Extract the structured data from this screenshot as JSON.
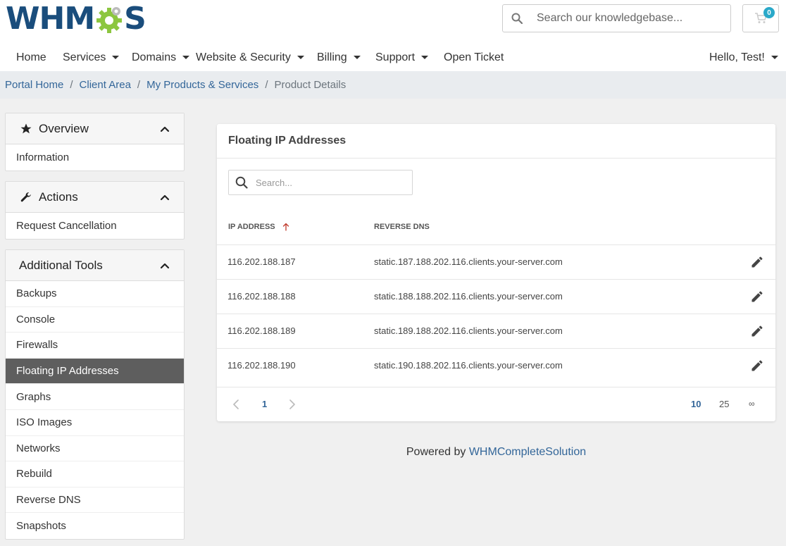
{
  "header": {
    "logo_letters_left": "WHM",
    "logo_letters_right": "S",
    "search_placeholder": "Search our knowledgebase...",
    "cart_count": "0"
  },
  "nav": {
    "items": [
      {
        "label": "Home",
        "dropdown": false
      },
      {
        "label": "Services",
        "dropdown": true
      },
      {
        "label": "Domains",
        "dropdown": true
      },
      {
        "label": "Website & Security",
        "dropdown": true
      },
      {
        "label": "Billing",
        "dropdown": true
      },
      {
        "label": "Support",
        "dropdown": true
      },
      {
        "label": "Open Ticket",
        "dropdown": false
      }
    ],
    "user_greeting": "Hello, Test!"
  },
  "breadcrumb": {
    "links": [
      "Portal Home",
      "Client Area",
      "My Products & Services"
    ],
    "separator": "/",
    "active": "Product Details"
  },
  "sidebar": {
    "overview": {
      "title": "Overview",
      "items": [
        "Information"
      ]
    },
    "actions": {
      "title": "Actions",
      "items": [
        "Request Cancellation"
      ]
    },
    "tools": {
      "title": "Additional Tools",
      "items": [
        "Backups",
        "Console",
        "Firewalls",
        "Floating IP Addresses",
        "Graphs",
        "ISO Images",
        "Networks",
        "Rebuild",
        "Reverse DNS",
        "Snapshots"
      ],
      "active": "Floating IP Addresses"
    }
  },
  "main": {
    "title": "Floating IP Addresses",
    "search_placeholder": "Search...",
    "columns": {
      "ip": "IP ADDRESS",
      "dns": "REVERSE DNS"
    },
    "rows": [
      {
        "ip": "116.202.188.187",
        "dns": "static.187.188.202.116.clients.your-server.com"
      },
      {
        "ip": "116.202.188.188",
        "dns": "static.188.188.202.116.clients.your-server.com"
      },
      {
        "ip": "116.202.188.189",
        "dns": "static.189.188.202.116.clients.your-server.com"
      },
      {
        "ip": "116.202.188.190",
        "dns": "static.190.188.202.116.clients.your-server.com"
      }
    ],
    "pagination": {
      "current_page": "1",
      "page_sizes": [
        "10",
        "25",
        "∞"
      ],
      "active_page_size": "10"
    }
  },
  "footer": {
    "prefix": "Powered by",
    "link": "WHMCompleteSolution"
  },
  "colors": {
    "brand_blue": "#1a4d7c",
    "gear_green": "#8cc63f",
    "link_blue": "#336699",
    "active_item": "#5e5e5e",
    "badge": "#2aa9c9"
  }
}
